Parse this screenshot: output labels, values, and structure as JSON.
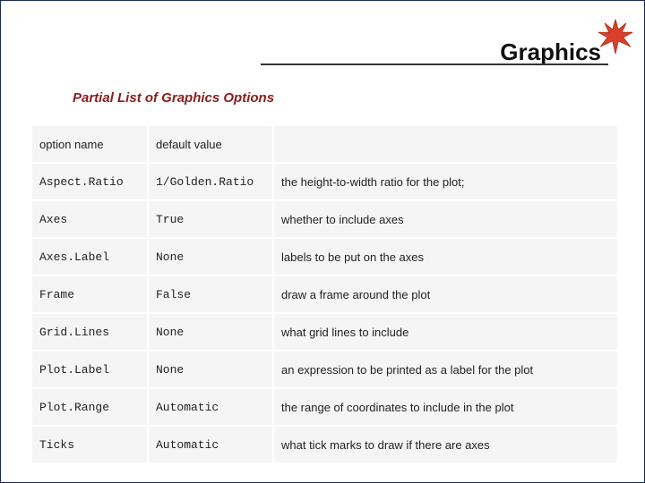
{
  "title": "Graphics",
  "subtitle": "Partial List of Graphics Options",
  "table": {
    "headers": {
      "c1": "option name",
      "c2": "default value",
      "c3": ""
    },
    "rows": [
      {
        "name": "Aspect.Ratio",
        "default": "1/Golden.Ratio",
        "desc": "the height-to-width ratio for the plot;"
      },
      {
        "name": "Axes",
        "default": "True",
        "desc": "whether to include axes"
      },
      {
        "name": "Axes.Label",
        "default": "None",
        "desc": "labels to be put on the axes"
      },
      {
        "name": "Frame",
        "default": "False",
        "desc": "draw a frame around the plot"
      },
      {
        "name": "Grid.Lines",
        "default": "None",
        "desc": "what grid lines to include"
      },
      {
        "name": "Plot.Label",
        "default": "None",
        "desc": "an expression to be printed as a label for the plot"
      },
      {
        "name": "Plot.Range",
        "default": "Automatic",
        "desc": "the range of coordinates to include in the plot"
      },
      {
        "name": "Ticks",
        "default": "Automatic",
        "desc": "what tick marks to draw if there are axes"
      }
    ]
  }
}
